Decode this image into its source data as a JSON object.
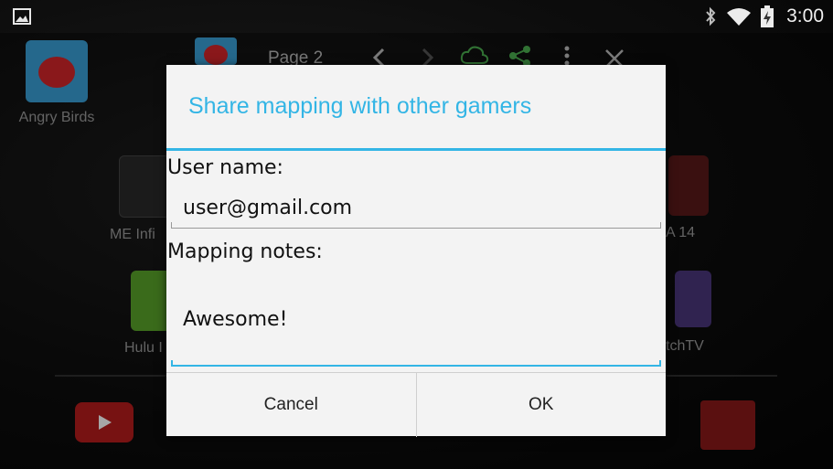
{
  "status_bar": {
    "time": "3:00",
    "icons": [
      "image-notification-icon",
      "bluetooth-icon",
      "wifi-icon",
      "battery-charging-icon"
    ]
  },
  "background": {
    "apps": [
      {
        "label": "Angry Birds"
      },
      {
        "label": "ME Infi"
      },
      {
        "label": "A 14"
      },
      {
        "label": "Hulu I"
      },
      {
        "label": "tchTV"
      }
    ],
    "toolbar": {
      "page_label": "Page 2",
      "icons": [
        "chevron-left-icon",
        "chevron-right-icon",
        "cloud-sync-icon",
        "share-icon",
        "overflow-menu-icon",
        "close-icon"
      ]
    }
  },
  "dialog": {
    "title": "Share mapping with other gamers",
    "username": {
      "label": "User name:",
      "value": "user@gmail.com"
    },
    "notes": {
      "label": "Mapping notes:",
      "value": "Awesome!"
    },
    "cancel_label": "Cancel",
    "ok_label": "OK"
  },
  "colors": {
    "accent": "#33b5e5",
    "dialog_bg": "#f3f3f3",
    "background": "#0a0a0a"
  }
}
